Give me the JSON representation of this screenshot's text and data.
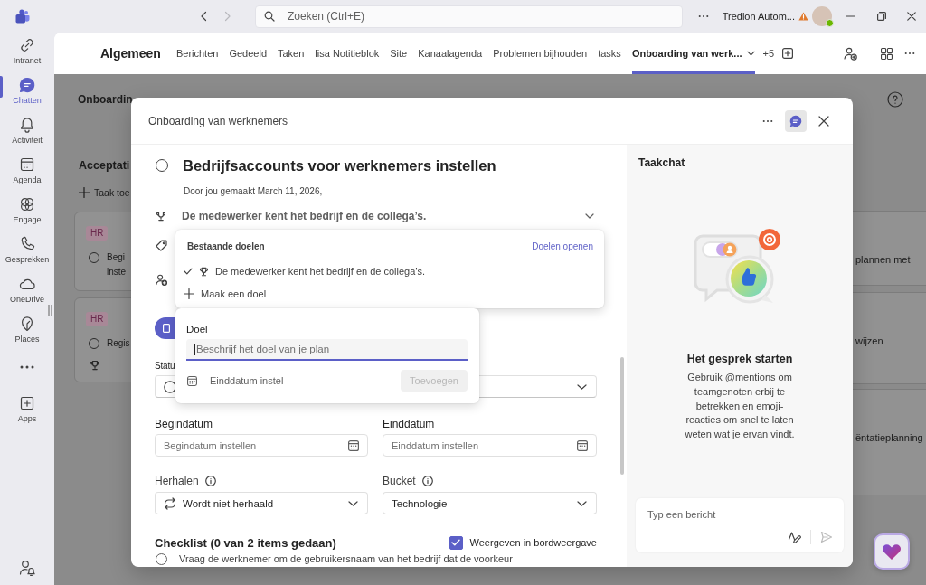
{
  "title_bar": {
    "nav": [
      {
        "disabled": false
      },
      {
        "disabled": true
      }
    ],
    "search": {
      "placeholder": "Zoeken (Ctrl+E)"
    },
    "account": "Tredion Autom...",
    "available": true
  },
  "rail": {
    "items": [
      {
        "kind": "app",
        "label": "Intranet",
        "selected": false
      },
      {
        "kind": "app",
        "label": "Chatten",
        "selected": true
      },
      {
        "kind": "app",
        "label": "Activiteit",
        "selected": false
      },
      {
        "kind": "app",
        "label": "Agenda",
        "selected": false
      },
      {
        "kind": "app",
        "label": "Engage",
        "selected": false
      },
      {
        "kind": "app",
        "label": "Gesprekken",
        "selected": false
      },
      {
        "kind": "app",
        "label": "OneDrive",
        "selected": false
      },
      {
        "kind": "app",
        "label": "Places",
        "selected": false
      },
      {
        "kind": "more",
        "selected": false
      },
      {
        "kind": "app",
        "label": "Apps",
        "selected": false
      }
    ]
  },
  "channel": {
    "name": "Algemeen",
    "tabs": [
      {
        "label": "Berichten",
        "selected": false
      },
      {
        "label": "Gedeeld",
        "selected": false
      },
      {
        "label": "Taken",
        "selected": false
      },
      {
        "label": "lisa Notitieblok",
        "selected": false
      },
      {
        "label": "Site",
        "selected": false
      },
      {
        "label": "Kanaalagenda",
        "selected": false
      },
      {
        "label": "Problemen bijhouden",
        "selected": false
      },
      {
        "label": "tasks",
        "selected": false
      },
      {
        "label": "Onboarding van werk...",
        "selected": true
      }
    ],
    "more_tabs": "+5"
  },
  "board": {
    "title": "Onboardin",
    "columns": [
      {
        "title": "Acceptati",
        "add_label": "Taak toe",
        "cards": [
          {
            "tag": "HR",
            "completed": false,
            "title": [
              "Begi",
              "inste"
            ],
            "goal": false
          },
          {
            "tag": "HR",
            "completed": false,
            "title": [
              "Regis"
            ],
            "goal": true
          }
        ]
      },
      {
        "cards": [
          {
            "title": [
              "plannen met"
            ]
          },
          {
            "title": [
              "wijzen"
            ]
          },
          {
            "title": [
              "ëntatieplanning"
            ]
          }
        ]
      }
    ]
  },
  "task_dialog": {
    "plan": "Onboarding van werknemers",
    "chat_selected": true,
    "task": {
      "completed": false,
      "title": "Bedrijfsaccounts voor werknemers instellen",
      "created": "Door jou gemaakt March 11, 2026,",
      "goal": "De medewerker kent het bedrijf en de collega’s."
    },
    "goal_menu": {
      "heading": "Bestaande doelen",
      "link": "Doelen openen",
      "goals": [
        {
          "label": "De medewerker kent het bedrijf en de collega’s.",
          "checked": true
        }
      ],
      "create_label": "Maak een doel"
    },
    "goal_form": {
      "label": "Doel",
      "placeholder": "Beschrijf het doel van je plan",
      "date_label": "Einddatum instel",
      "submit": {
        "label": "Toevoegen",
        "disabled": true
      }
    },
    "status_label": "Statu",
    "date_fields": [
      {
        "label": "Begindatum",
        "placeholder": "Begindatum instellen"
      },
      {
        "label": "Einddatum",
        "placeholder": "Einddatum instellen"
      }
    ],
    "selects": [
      {
        "kind": "repeat",
        "label": "Herhalen",
        "info": true,
        "value": "Wordt niet herhaald"
      },
      {
        "kind": "plain",
        "label": "Bucket",
        "info": true,
        "value": "Technologie"
      }
    ],
    "checklist": {
      "title": "Checklist (0 van 2 items gedaan)",
      "show_on_board": {
        "label": "Weergeven in bordweergave",
        "checked": true
      },
      "items": [
        {
          "label": "Vraag de werknemer om de gebruikersnaam van het bedrijf dat de voorkeur",
          "checked": false
        }
      ]
    }
  },
  "chat": {
    "title": "Taakchat",
    "heading": "Het gesprek starten",
    "text": "Gebruik @mentions om teamgenoten erbij te betrekken en emoji-reacties om snel te laten weten wat je ervan vindt.",
    "input": {
      "placeholder": "Typ een bericht"
    }
  }
}
